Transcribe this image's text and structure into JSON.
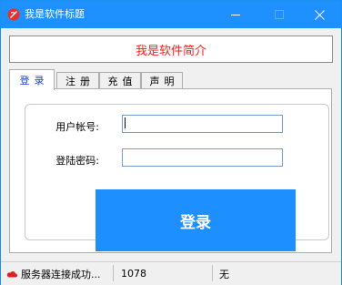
{
  "window": {
    "title": "我是软件标题",
    "banner": "我是软件简介",
    "accent": "#1e90ff"
  },
  "tabs": [
    {
      "label": "登录",
      "active": true
    },
    {
      "label": "注册",
      "active": false
    },
    {
      "label": "充值",
      "active": false
    },
    {
      "label": "声明",
      "active": false
    }
  ],
  "login": {
    "account_label": "用户帐号:",
    "account_value": "",
    "password_label": "登陆密码:",
    "password_value": "",
    "submit_label": "登录"
  },
  "statusbar": {
    "status_text": "服务器连接成功...",
    "code": "1078",
    "extra": "无"
  },
  "icons": {
    "app": "app-logo-icon",
    "cloud": "cloud-icon"
  }
}
